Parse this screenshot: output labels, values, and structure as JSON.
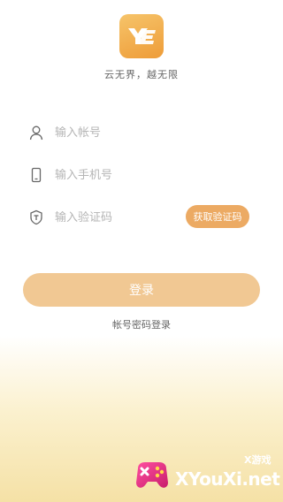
{
  "app": {
    "slogan": "云无界，越无限"
  },
  "form": {
    "account_placeholder": "输入帐号",
    "phone_placeholder": "输入手机号",
    "code_placeholder": "输入验证码",
    "get_code_label": "获取验证码"
  },
  "actions": {
    "login_label": "登录",
    "alt_login_label": "帐号密码登录"
  },
  "watermark": {
    "text": "XYouXi.net",
    "small": "X游戏"
  },
  "colors": {
    "accent": "#ecaa63",
    "login_button": "#f1c893"
  }
}
